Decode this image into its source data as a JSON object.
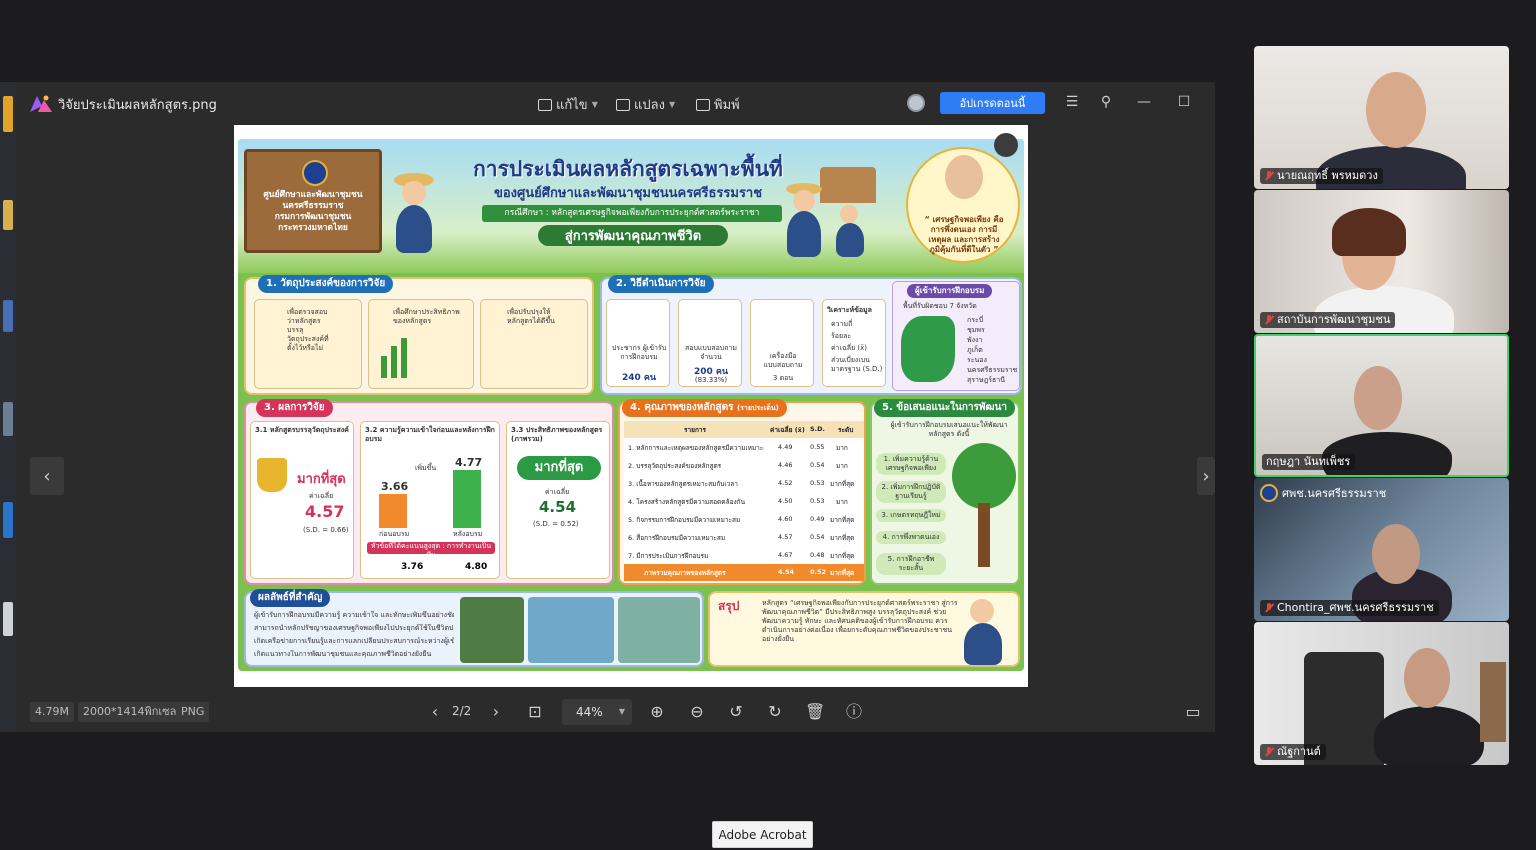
{
  "viewer": {
    "file_title": "วิจัยประเมินผลหลักสูตร.png",
    "menu_edit": "แก้ไข",
    "menu_convert": "แปลง",
    "menu_print": "พิมพ์",
    "upgrade_label": "อัปเกรดตอนนี้",
    "size_info": "4.79M",
    "dimensions_info": "2000*1414พิกเซล",
    "format_info": "PNG",
    "page_indicator": "2/2",
    "zoom_level": "44%"
  },
  "poster": {
    "agency_line1": "ศูนย์ศึกษาและพัฒนาชุมชน",
    "agency_line2": "นครศรีธรรมราช",
    "agency_line3": "กรมการพัฒนาชุมชน",
    "agency_line4": "กระทรวงมหาดไทย",
    "title": "การประเมินผลหลักสูตรเฉพาะพื้นที่",
    "subtitle": "ของศูนย์ศึกษาและพัฒนาชุมชนนครศรีธรรมราช",
    "case_study": "กรณีศึกษา : หลักสูตรเศรษฐกิจพอเพียงกับการประยุกต์ศาสตร์พระราชา",
    "goal": "สู่การพัฒนาคุณภาพชีวิต",
    "bubble_quote": "“ เศรษฐกิจพอเพียง คือ การพึ่งตนเอง การมีเหตุผล และการสร้างภูมิคุ้มกันที่ดีในตัว ”",
    "s1_title": "1. วัตถุประสงค์ของการวิจัย",
    "s1_items": [
      "เพื่อตรวจสอบว่าหลักสูตรบรรลุวัตถุประสงค์ที่ตั้งไว้หรือไม่",
      "เพื่อศึกษาประสิทธิภาพของหลักสูตร",
      "เพื่อปรับปรุงให้หลักสูตรได้ดีขึ้น"
    ],
    "s2_title": "2. วิธีดำเนินการวิจัย",
    "s2_population_label": "ประชากร ผู้เข้ารับการฝึกอบรม",
    "s2_population_value": "240 คน",
    "s2_sample_label": "สอบแบบสอบถาม จำนวน",
    "s2_sample_value": "200 คน",
    "s2_sample_pct": "(83.33%)",
    "s2_tool_label": "เครื่องมือ แบบสอบถาม",
    "s2_tool_value": "3 ตอน",
    "s2_analysis_title": "วิเคราะห์ข้อมูล",
    "s2_analysis_items": [
      "ความถี่",
      "ร้อยละ",
      "ค่าเฉลี่ย (x̄)",
      "ส่วนเบี่ยงเบนมาตรฐาน (S.D.)"
    ],
    "trainees_title": "ผู้เข้ารับการฝึกอบรม",
    "trainees_sub": "พื้นที่รับผิดชอบ 7 จังหวัด",
    "provinces": [
      "กระบี่",
      "ชุมพร",
      "พังงา",
      "ภูเก็ต",
      "ระนอง",
      "นครศรีธรรมราช",
      "สุราษฎร์ธานี"
    ],
    "s3_title": "3. ผลการวิจัย",
    "s31_title": "3.1 หลักสูตรบรรลุวัตถุประสงค์",
    "s31_level": "มากที่สุด",
    "s31_mean_label": "ค่าเฉลี่ย",
    "s31_mean": "4.57",
    "s31_sd": "(S.D. = 0.66)",
    "s32_title": "3.2 ความรู้ความเข้าใจก่อนและหลังการฝึกอบรม",
    "s32_increase": "เพิ่มขึ้น",
    "s32_before": "3.66",
    "s32_after": "4.77",
    "s32_before_label": "ก่อนอบรม",
    "s32_after_label": "หลังอบรม",
    "s32_topic": "หัวข้อที่ได้คะแนนสูงสุด : การทำงานเป็นทีม",
    "s32_topic_before": "3.76",
    "s32_topic_after": "4.80",
    "s33_title": "3.3 ประสิทธิภาพของหลักสูตร (ภาพรวม)",
    "s33_level": "มากที่สุด",
    "s33_mean_label": "ค่าเฉลี่ย",
    "s33_mean": "4.54",
    "s33_sd": "(S.D. = 0.52)",
    "s4_title": "4. คุณภาพของหลักสูตร",
    "s4_title_note": "(รายประเด็น)",
    "s4_headers": [
      "รายการ",
      "ค่าเฉลี่ย (x̄)",
      "S.D.",
      "ระดับ"
    ],
    "s4_rows": [
      {
        "item": "1. หลักการและเหตุผลของหลักสูตรมีความเหมาะสม",
        "mean": "4.49",
        "sd": "0.55",
        "level": "มาก"
      },
      {
        "item": "2. บรรลุวัตถุประสงค์ของหลักสูตร",
        "mean": "4.46",
        "sd": "0.54",
        "level": "มาก"
      },
      {
        "item": "3. เนื้อหาของหลักสูตรเหมาะสมกับเวลา",
        "mean": "4.52",
        "sd": "0.53",
        "level": "มากที่สุด"
      },
      {
        "item": "4. โครงสร้างหลักสูตรมีความสอดคล้องกัน",
        "mean": "4.50",
        "sd": "0.53",
        "level": "มาก"
      },
      {
        "item": "5. กิจกรรมการฝึกอบรมมีความเหมาะสม",
        "mean": "4.60",
        "sd": "0.49",
        "level": "มากที่สุด"
      },
      {
        "item": "6. สื่อการฝึกอบรมมีความเหมาะสม",
        "mean": "4.57",
        "sd": "0.54",
        "level": "มากที่สุด"
      },
      {
        "item": "7. มีการประเมินการฝึกอบรม",
        "mean": "4.67",
        "sd": "0.48",
        "level": "มากที่สุด"
      }
    ],
    "s4_total_label": "ภาพรวมคุณภาพของหลักสูตร",
    "s4_total_mean": "4.54",
    "s4_total_sd": "0.52",
    "s4_total_level": "มากที่สุด",
    "s5_title": "5. ข้อเสนอแนะในการพัฒนา",
    "s5_intro": "ผู้เข้ารับการฝึกอบรมเสนอแนะให้พัฒนาหลักสูตร ดังนี้",
    "s5_items": [
      "1. เพิ่มความรู้ด้านเศรษฐกิจพอเพียง",
      "2. เพิ่มการฝึกปฏิบัติฐานเรียนรู้",
      "3. เกษตรทฤษฎีใหม่",
      "4. การพึ่งพาตนเอง",
      "5. การฝึกอาชีพระยะสั้น"
    ],
    "outcome_title": "ผลลัพธ์ที่สำคัญ",
    "outcome_items": [
      "ผู้เข้ารับการฝึกอบรมมีความรู้ ความเข้าใจ และทักษะเพิ่มขึ้นอย่างชัดเจน",
      "สามารถนำหลักปรัชญาของเศรษฐกิจพอเพียงไปประยุกต์ใช้ในชีวิตประจำวันได้",
      "เกิดเครือข่ายการเรียนรู้และการแลกเปลี่ยนประสบการณ์ระหว่างผู้เข้ารับการฝึกอบรม",
      "เกิดแนวทางในการพัฒนาชุมชนและคุณภาพชีวิตอย่างยั่งยืน"
    ],
    "summary_title": "สรุป",
    "summary_text": "หลักสูตร “เศรษฐกิจพอเพียงกับการประยุกต์ศาสตร์พระราชา สู่การพัฒนาคุณภาพชีวิต” มีประสิทธิภาพสูง บรรลุวัตถุประสงค์ ช่วยพัฒนาความรู้ ทักษะ และทัศนคติของผู้เข้ารับการฝึกอบรม ควรดำเนินการอย่างต่อเนื่อง เพื่อยกระดับคุณภาพชีวิตของประชาชนอย่างยั่งยืน"
  },
  "participants": [
    {
      "name": "นายณฤทธิ์ พรหมดวง",
      "muted": true
    },
    {
      "name": "สถาบันการพัฒนาชุมชน",
      "muted": true
    },
    {
      "name": "กฤษฎา นันทเพ็ชร",
      "muted": false
    },
    {
      "name": "ศพช.นครศรีธรรมราช",
      "muted": false
    },
    {
      "name": "Chontira_ศพช.นครศรีธรรมราช",
      "muted": true
    },
    {
      "name": "ณัฐกานต์",
      "muted": true
    }
  ],
  "tooltip": "Adobe Acrobat",
  "colors": {
    "accent": "#2f7df6",
    "active_speaker": "#3fd46b",
    "mic_off": "#e24545"
  }
}
